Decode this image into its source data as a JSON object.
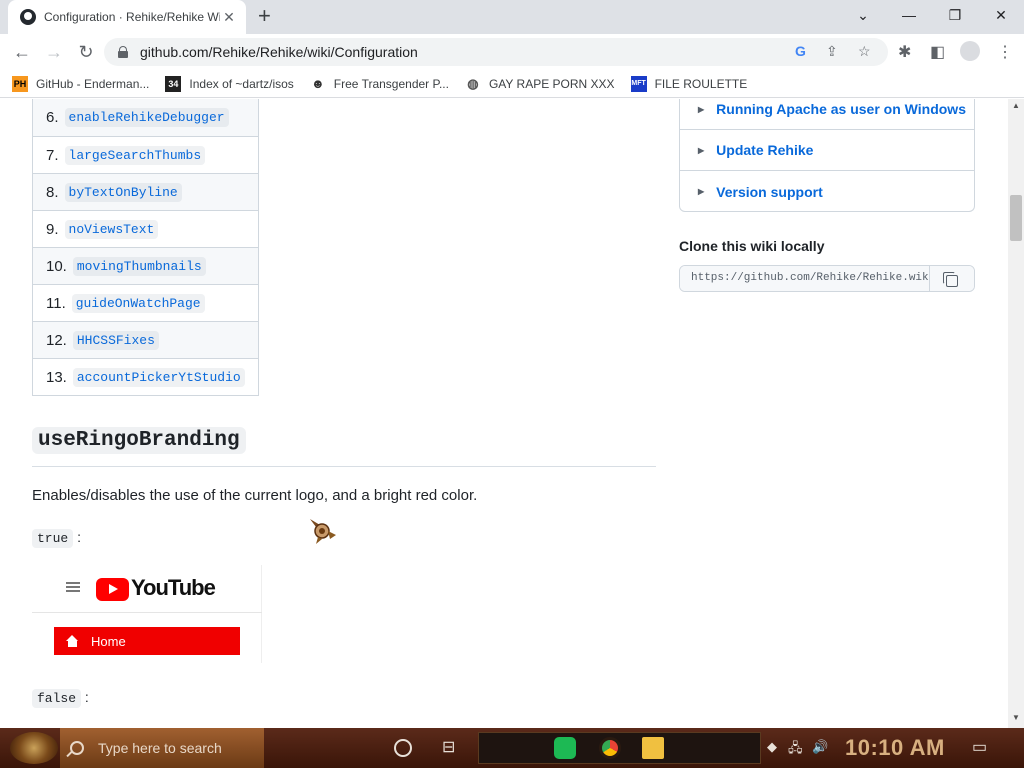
{
  "browser": {
    "tab_title": "Configuration · Rehike/Rehike Wiki",
    "url": "github.com/Rehike/Rehike/wiki/Configuration"
  },
  "bookmarks": [
    {
      "label": "GitHub - Enderman...",
      "icon": "PH"
    },
    {
      "label": "Index of ~dartz/isos",
      "icon": "34"
    },
    {
      "label": "Free Transgender P...",
      "icon": "mask"
    },
    {
      "label": "GAY RAPE PORN XXX",
      "icon": "globe"
    },
    {
      "label": "FILE ROULETTE",
      "icon": "MFT"
    }
  ],
  "toc": [
    {
      "num": "6.",
      "label": "enableRehikeDebugger"
    },
    {
      "num": "7.",
      "label": "largeSearchThumbs"
    },
    {
      "num": "8.",
      "label": "byTextOnByline"
    },
    {
      "num": "9.",
      "label": "noViewsText"
    },
    {
      "num": "10.",
      "label": "movingThumbnails"
    },
    {
      "num": "11.",
      "label": "guideOnWatchPage"
    },
    {
      "num": "12.",
      "label": "HHCSSFixes"
    },
    {
      "num": "13.",
      "label": "accountPickerYtStudio"
    }
  ],
  "section": {
    "heading": "useRingoBranding",
    "description": "Enables/disables the use of the current logo, and a bright red color.",
    "true_label": "true",
    "false_label": "false",
    "colon": ":"
  },
  "youtube_preview": {
    "brand": "YouTube",
    "home_label": "Home",
    "brand_color": "#ff0000"
  },
  "sidebar": {
    "pages": [
      "Running Apache as user on Windows",
      "Update Rehike",
      "Version support"
    ],
    "clone_heading": "Clone this wiki locally",
    "clone_url": "https://github.com/Rehike/Rehike.wiki.git"
  },
  "taskbar": {
    "search_placeholder": "Type here to search",
    "time": "10:10 AM"
  },
  "colors": {
    "link": "#0969da",
    "taskbar": "#4a1f10"
  }
}
